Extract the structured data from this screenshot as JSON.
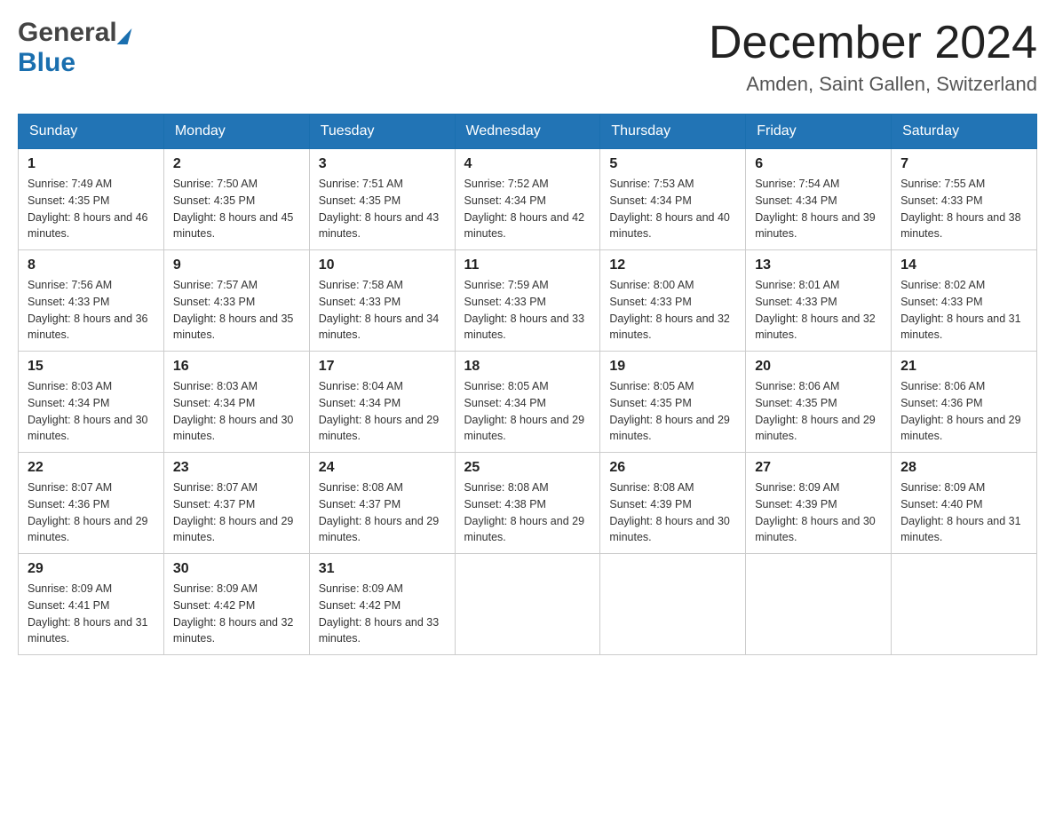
{
  "logo": {
    "general": "General",
    "blue": "Blue"
  },
  "title": {
    "month_year": "December 2024",
    "location": "Amden, Saint Gallen, Switzerland"
  },
  "headers": [
    "Sunday",
    "Monday",
    "Tuesday",
    "Wednesday",
    "Thursday",
    "Friday",
    "Saturday"
  ],
  "weeks": [
    [
      {
        "day": "1",
        "sunrise": "7:49 AM",
        "sunset": "4:35 PM",
        "daylight": "8 hours and 46 minutes."
      },
      {
        "day": "2",
        "sunrise": "7:50 AM",
        "sunset": "4:35 PM",
        "daylight": "8 hours and 45 minutes."
      },
      {
        "day": "3",
        "sunrise": "7:51 AM",
        "sunset": "4:35 PM",
        "daylight": "8 hours and 43 minutes."
      },
      {
        "day": "4",
        "sunrise": "7:52 AM",
        "sunset": "4:34 PM",
        "daylight": "8 hours and 42 minutes."
      },
      {
        "day": "5",
        "sunrise": "7:53 AM",
        "sunset": "4:34 PM",
        "daylight": "8 hours and 40 minutes."
      },
      {
        "day": "6",
        "sunrise": "7:54 AM",
        "sunset": "4:34 PM",
        "daylight": "8 hours and 39 minutes."
      },
      {
        "day": "7",
        "sunrise": "7:55 AM",
        "sunset": "4:33 PM",
        "daylight": "8 hours and 38 minutes."
      }
    ],
    [
      {
        "day": "8",
        "sunrise": "7:56 AM",
        "sunset": "4:33 PM",
        "daylight": "8 hours and 36 minutes."
      },
      {
        "day": "9",
        "sunrise": "7:57 AM",
        "sunset": "4:33 PM",
        "daylight": "8 hours and 35 minutes."
      },
      {
        "day": "10",
        "sunrise": "7:58 AM",
        "sunset": "4:33 PM",
        "daylight": "8 hours and 34 minutes."
      },
      {
        "day": "11",
        "sunrise": "7:59 AM",
        "sunset": "4:33 PM",
        "daylight": "8 hours and 33 minutes."
      },
      {
        "day": "12",
        "sunrise": "8:00 AM",
        "sunset": "4:33 PM",
        "daylight": "8 hours and 32 minutes."
      },
      {
        "day": "13",
        "sunrise": "8:01 AM",
        "sunset": "4:33 PM",
        "daylight": "8 hours and 32 minutes."
      },
      {
        "day": "14",
        "sunrise": "8:02 AM",
        "sunset": "4:33 PM",
        "daylight": "8 hours and 31 minutes."
      }
    ],
    [
      {
        "day": "15",
        "sunrise": "8:03 AM",
        "sunset": "4:34 PM",
        "daylight": "8 hours and 30 minutes."
      },
      {
        "day": "16",
        "sunrise": "8:03 AM",
        "sunset": "4:34 PM",
        "daylight": "8 hours and 30 minutes."
      },
      {
        "day": "17",
        "sunrise": "8:04 AM",
        "sunset": "4:34 PM",
        "daylight": "8 hours and 29 minutes."
      },
      {
        "day": "18",
        "sunrise": "8:05 AM",
        "sunset": "4:34 PM",
        "daylight": "8 hours and 29 minutes."
      },
      {
        "day": "19",
        "sunrise": "8:05 AM",
        "sunset": "4:35 PM",
        "daylight": "8 hours and 29 minutes."
      },
      {
        "day": "20",
        "sunrise": "8:06 AM",
        "sunset": "4:35 PM",
        "daylight": "8 hours and 29 minutes."
      },
      {
        "day": "21",
        "sunrise": "8:06 AM",
        "sunset": "4:36 PM",
        "daylight": "8 hours and 29 minutes."
      }
    ],
    [
      {
        "day": "22",
        "sunrise": "8:07 AM",
        "sunset": "4:36 PM",
        "daylight": "8 hours and 29 minutes."
      },
      {
        "day": "23",
        "sunrise": "8:07 AM",
        "sunset": "4:37 PM",
        "daylight": "8 hours and 29 minutes."
      },
      {
        "day": "24",
        "sunrise": "8:08 AM",
        "sunset": "4:37 PM",
        "daylight": "8 hours and 29 minutes."
      },
      {
        "day": "25",
        "sunrise": "8:08 AM",
        "sunset": "4:38 PM",
        "daylight": "8 hours and 29 minutes."
      },
      {
        "day": "26",
        "sunrise": "8:08 AM",
        "sunset": "4:39 PM",
        "daylight": "8 hours and 30 minutes."
      },
      {
        "day": "27",
        "sunrise": "8:09 AM",
        "sunset": "4:39 PM",
        "daylight": "8 hours and 30 minutes."
      },
      {
        "day": "28",
        "sunrise": "8:09 AM",
        "sunset": "4:40 PM",
        "daylight": "8 hours and 31 minutes."
      }
    ],
    [
      {
        "day": "29",
        "sunrise": "8:09 AM",
        "sunset": "4:41 PM",
        "daylight": "8 hours and 31 minutes."
      },
      {
        "day": "30",
        "sunrise": "8:09 AM",
        "sunset": "4:42 PM",
        "daylight": "8 hours and 32 minutes."
      },
      {
        "day": "31",
        "sunrise": "8:09 AM",
        "sunset": "4:42 PM",
        "daylight": "8 hours and 33 minutes."
      },
      null,
      null,
      null,
      null
    ]
  ],
  "cell_labels": {
    "sunrise": "Sunrise: ",
    "sunset": "Sunset: ",
    "daylight": "Daylight: "
  }
}
